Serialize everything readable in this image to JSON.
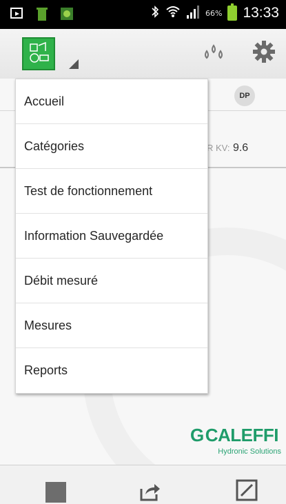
{
  "status_bar": {
    "battery_percent": "66%",
    "time": "13:33"
  },
  "badge": {
    "label": "DP"
  },
  "readout": {
    "label": "R KV:",
    "value": "9.6"
  },
  "menu": {
    "items": [
      {
        "label": "Accueil"
      },
      {
        "label": "Catégories"
      },
      {
        "label": "Test de fonctionnement"
      },
      {
        "label": "Information Sauvegardée"
      },
      {
        "label": "Débit mesuré"
      },
      {
        "label": "Mesures"
      },
      {
        "label": "Reports"
      }
    ]
  },
  "brand": {
    "name": "CALEFFI",
    "tagline": "Hydronic Solutions",
    "color": "#1f9c6a"
  },
  "icons": {
    "app_logo": "app-logo-icon",
    "drops": "water-drops-icon",
    "settings": "gear-icon",
    "stop": "stop-icon",
    "share": "share-icon",
    "resize": "resize-icon"
  },
  "colors": {
    "app_logo": "#2fb24a",
    "battery": "#8fcf2f"
  }
}
